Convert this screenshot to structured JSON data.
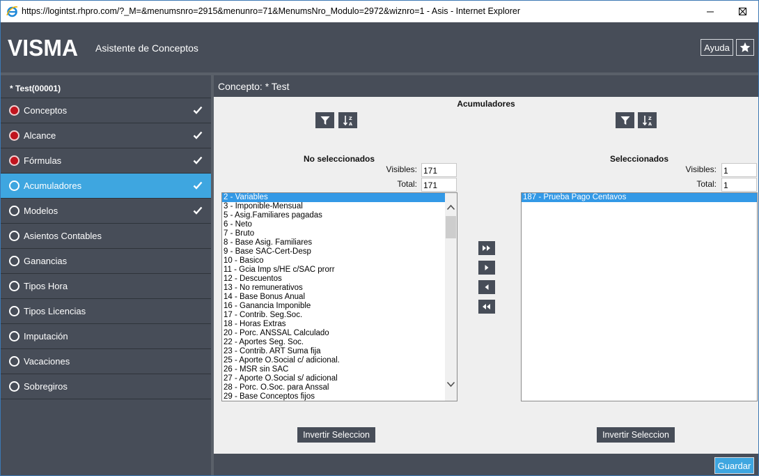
{
  "browser": {
    "url_title": "https://logintst.rhpro.com/?_M=&menumsnro=2915&menunro=71&MenumsNro_Modulo=2972&wiznro=1 - Asis - Internet Explorer"
  },
  "header": {
    "logo": "VISMA",
    "title": "Asistente de Conceptos",
    "help_label": "Ayuda"
  },
  "sidebar": {
    "heading": "* Test(00001)",
    "items": [
      {
        "label": "Conceptos",
        "status": "red",
        "checked": true
      },
      {
        "label": "Alcance",
        "status": "red",
        "checked": true
      },
      {
        "label": "Fórmulas",
        "status": "red",
        "checked": true
      },
      {
        "label": "Acumuladores",
        "status": "empty",
        "checked": true,
        "active": true
      },
      {
        "label": "Modelos",
        "status": "empty",
        "checked": true
      },
      {
        "label": "Asientos Contables",
        "status": "empty",
        "checked": false
      },
      {
        "label": "Ganancias",
        "status": "empty",
        "checked": false
      },
      {
        "label": "Tipos Hora",
        "status": "empty",
        "checked": false
      },
      {
        "label": "Tipos Licencias",
        "status": "empty",
        "checked": false
      },
      {
        "label": "Imputación",
        "status": "empty",
        "checked": false
      },
      {
        "label": "Vacaciones",
        "status": "empty",
        "checked": false
      },
      {
        "label": "Sobregiros",
        "status": "empty",
        "checked": false
      }
    ]
  },
  "main": {
    "heading": "Concepto: * Test",
    "section_title": "Acumuladores",
    "left": {
      "title": "No seleccionados",
      "visibles_label": "Visibles:",
      "visibles_value": "171",
      "total_label": "Total:",
      "total_value": "171",
      "items": [
        "2 - Variables",
        "3 - Imponible-Mensual",
        "5 - Asig.Familiares pagadas",
        "6 - Neto",
        "7 - Bruto",
        "8 - Base Asig. Familiares",
        "9 - Base SAC-Cert-Desp",
        "10 - Basico",
        "11 - Gcia Imp s/HE c/SAC prorr",
        "12 - Descuentos",
        "13 - No remunerativos",
        "14 - Base Bonus Anual",
        "16 - Ganancia Imponible",
        "17 - Contrib. Seg.Soc.",
        "18 - Horas Extras",
        "20 - Porc. ANSSAL Calculado",
        "22 - Aportes Seg. Soc.",
        "23 - Contrib. ART Suma fija",
        "25 - Aporte O.Social c/ adicional.",
        "26 - MSR sin SAC",
        "27 - Aporte O.Social s/ adicional",
        "28 - Porc. O.Soc. para Anssal",
        "29 - Base Conceptos fijos"
      ],
      "invert_label": "Invertir Seleccion"
    },
    "right": {
      "title": "Seleccionados",
      "visibles_label": "Visibles:",
      "visibles_value": "1",
      "total_label": "Total:",
      "total_value": "1",
      "items": [
        "187 - Prueba Pago Centavos"
      ],
      "invert_label": "Invertir Seleccion"
    },
    "save_label": "Guardar"
  },
  "colors": {
    "header_bg": "#474d58",
    "accent": "#3ea6e0",
    "status_red": "#c0141e",
    "selection": "#3399e6"
  }
}
